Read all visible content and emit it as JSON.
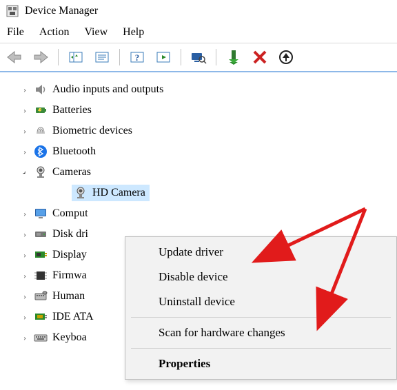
{
  "window": {
    "title": "Device Manager"
  },
  "menubar": {
    "file": "File",
    "action": "Action",
    "view": "View",
    "help": "Help"
  },
  "tree": {
    "items": [
      {
        "label": "Audio inputs and outputs",
        "icon": "speaker-icon",
        "expanded": false
      },
      {
        "label": "Batteries",
        "icon": "battery-icon",
        "expanded": false
      },
      {
        "label": "Biometric devices",
        "icon": "fingerprint-icon",
        "expanded": false
      },
      {
        "label": "Bluetooth",
        "icon": "bluetooth-icon",
        "expanded": false
      },
      {
        "label": "Cameras",
        "icon": "camera-icon",
        "expanded": true
      },
      {
        "label": "Computers",
        "icon": "monitor-icon",
        "expanded": false,
        "truncated": "Comput"
      },
      {
        "label": "Disk drives",
        "icon": "disk-icon",
        "expanded": false,
        "truncated": "Disk dri"
      },
      {
        "label": "Display adapters",
        "icon": "display-icon",
        "expanded": false,
        "truncated": "Display"
      },
      {
        "label": "Firmware",
        "icon": "firmware-icon",
        "expanded": false,
        "truncated": "Firmwa"
      },
      {
        "label": "Human Interface Devices",
        "icon": "hid-icon",
        "expanded": false,
        "truncated": "Human"
      },
      {
        "label": "IDE ATA/ATAPI controllers",
        "icon": "ide-icon",
        "expanded": false,
        "truncated": "IDE ATA"
      },
      {
        "label": "Keyboards",
        "icon": "keyboard-icon",
        "expanded": false,
        "truncated": "Keyboa"
      }
    ],
    "camera_child": {
      "label": "HD Camera",
      "icon": "camera-icon"
    }
  },
  "context_menu": {
    "update": "Update driver",
    "disable": "Disable device",
    "uninstall": "Uninstall device",
    "scan": "Scan for hardware changes",
    "properties": "Properties"
  },
  "annotation": {
    "color": "#e11b1b"
  }
}
